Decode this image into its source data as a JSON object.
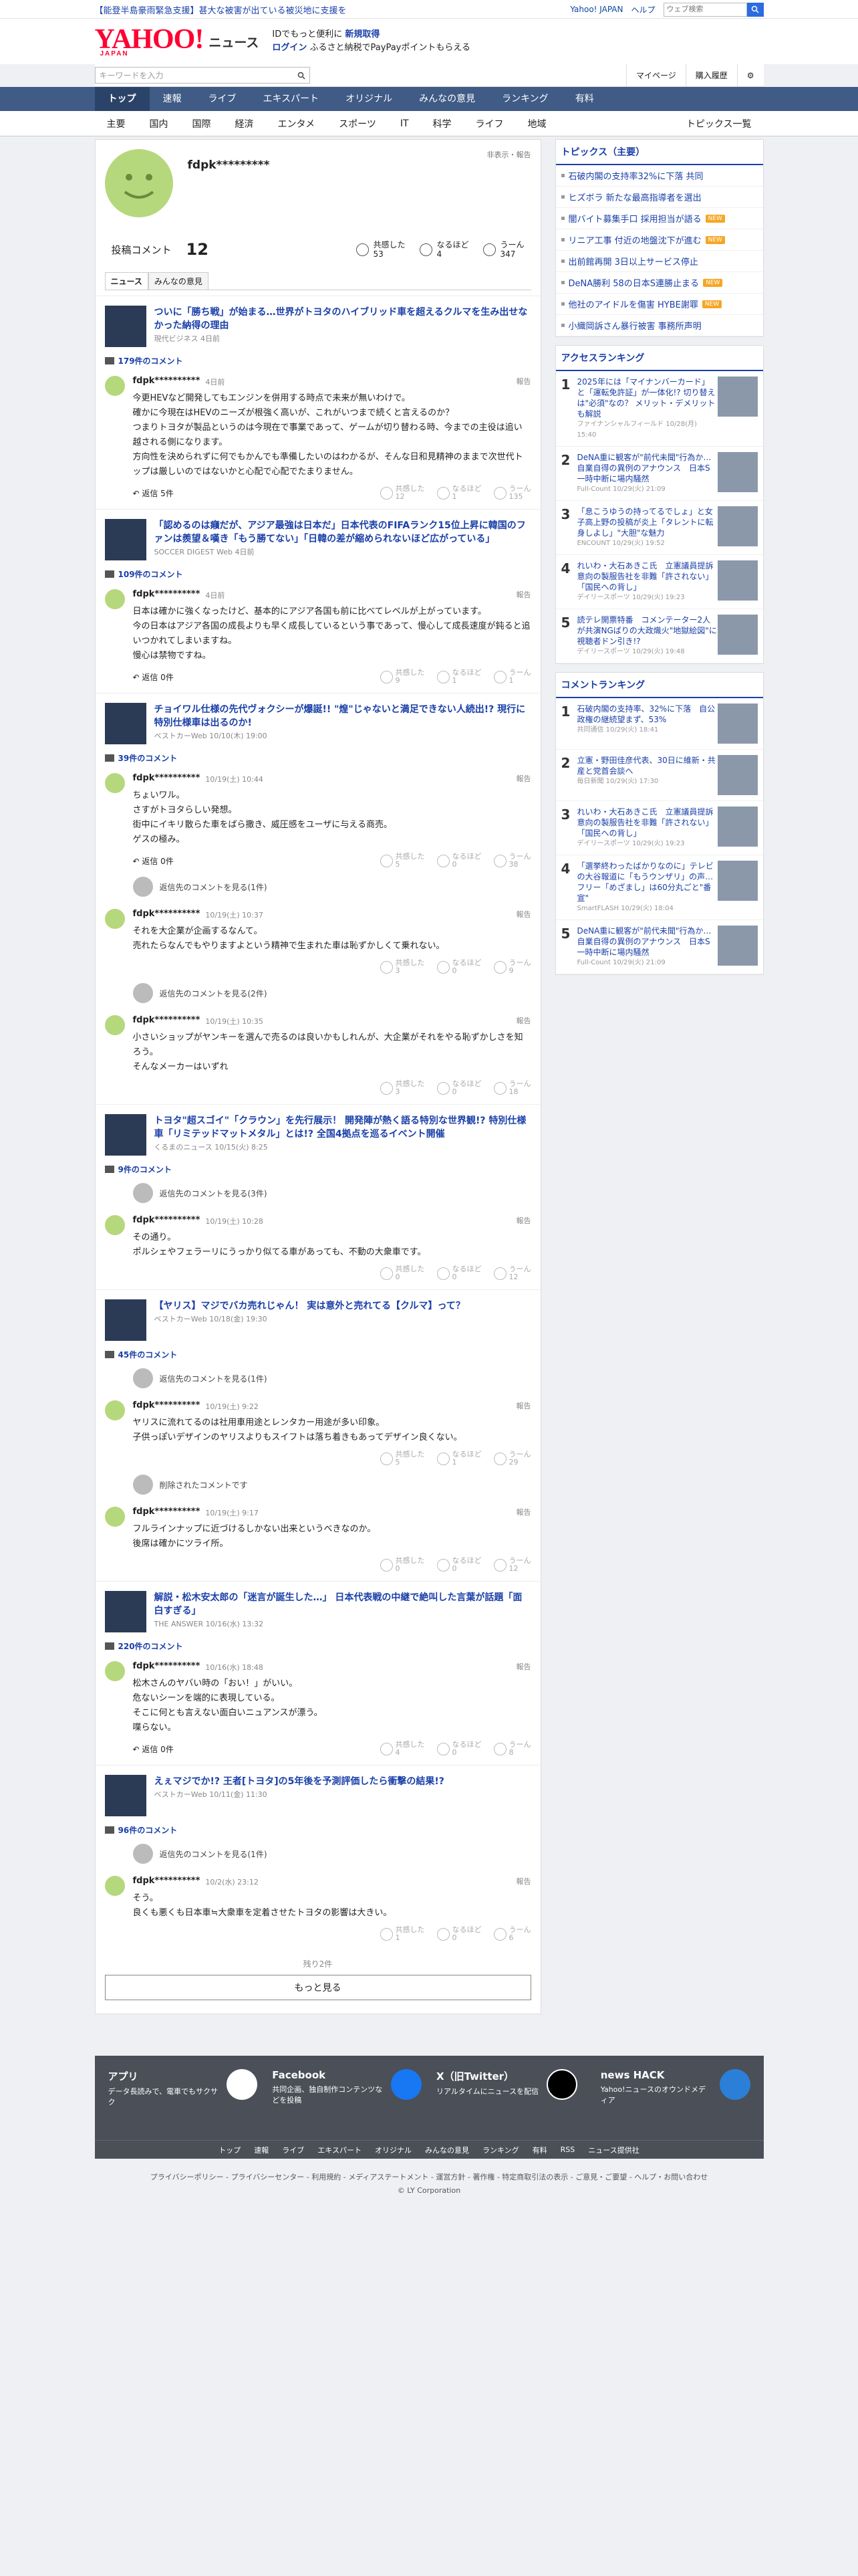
{
  "top": {
    "alert": "【能登半島豪雨緊急支援】甚大な被害が出ている被災地に支援を",
    "links": [
      "Yahoo! JAPAN",
      "ヘルプ"
    ],
    "search_placeholder": "ウェブ検索"
  },
  "header": {
    "logo": "YAHOO!",
    "logo_sub": "JAPAN",
    "logo_text": "ニュース",
    "promo1": "IDでもっと便利に",
    "promo1b": "新規取得",
    "promo2": "ログイン",
    "promo2b": "ふるさと納税でPayPayポイントもらえる"
  },
  "bar2": {
    "kw_placeholder": "キーワードを入力",
    "links": [
      "マイページ",
      "購入履歴"
    ]
  },
  "gnav": [
    "トップ",
    "速報",
    "ライブ",
    "エキスパート",
    "オリジナル",
    "みんなの意見",
    "ランキング",
    "有料"
  ],
  "snav": [
    "主要",
    "国内",
    "国際",
    "経済",
    "エンタメ",
    "スポーツ",
    "IT",
    "科学",
    "ライフ",
    "地域"
  ],
  "snav_right": "トピックス一覧",
  "profile": {
    "name": "fdpk*********",
    "report": "非表示・報告",
    "comments_label": "投稿コメント",
    "comments": "12",
    "reactions": [
      {
        "l": "共感した",
        "n": "53"
      },
      {
        "l": "なるほど",
        "n": "4"
      },
      {
        "l": "うーん",
        "n": "347"
      }
    ]
  },
  "tabs": [
    "ニュース",
    "みんなの意見"
  ],
  "articles": [
    {
      "title": "ついに「勝ち戦」が始まる…世界がトヨタのハイブリッド車を超えるクルマを生み出せなかった納得の理由",
      "src": "現代ビジネス 4日前",
      "count": "179件のコメント",
      "comments": [
        {
          "user": "fdpk**********",
          "date": "4日前",
          "text": "今更HEVなど開発してもエンジンを併用する時点で未来が無いわけで。\n確かに今現在はHEVのニーズが根強く高いが、これがいつまで続くと言えるのか？\nつまりトヨタが製品というのは今現在で事業であって、ゲームが切り替わる時、今までの主役は追い越される側になります。\n方向性を決められずに何でもかんでも準備したいのはわかるが、そんな日和見精神のままで次世代トップは厳しいのではないかと心配で心配でたまりません。",
          "reply": "返信 5件",
          "r": [
            "12",
            "1",
            "135"
          ]
        }
      ]
    },
    {
      "title": "「認めるのは癪だが、アジア最強は日本だ」日本代表のFIFAランク15位上昇に韓国のファンは羨望＆嘆き「もう勝てない」「日韓の差が縮められないほど広がっている」",
      "src": "SOCCER DIGEST Web 4日前",
      "count": "109件のコメント",
      "comments": [
        {
          "user": "fdpk**********",
          "date": "4日前",
          "text": "日本は確かに強くなったけど、基本的にアジア各国も前に比べてレベルが上がっています。\n今の日本はアジア各国の成長よりも早く成長しているという事であって、慢心して成長速度が鈍ると追いつかれてしまいますね。\n慢心は禁物ですね。",
          "reply": "返信 0件",
          "r": [
            "9",
            "1",
            "1"
          ]
        }
      ]
    },
    {
      "title": "チョイワル仕様の先代ヴォクシーが爆誕!! \"煌\"じゃないと満足できない人続出!? 現行に特別仕様車は出るのか!",
      "src": "ベストカーWeb 10/10(木) 19:00",
      "count": "39件のコメント",
      "comments": [
        {
          "user": "fdpk**********",
          "date": "10/19(土) 10:44",
          "text": "ちょいワル。\nさすがトヨタらしい発想。\n街中にイキリ散らた車をばら撒き、威圧感をユーザに与える商売。\nゲスの極み。",
          "reply": "返信 0件",
          "r": [
            "5",
            "0",
            "38"
          ]
        },
        {
          "user": "fdpk**********",
          "date": "10/19(土) 10:37",
          "text": "それを大企業が企画するなんて。\n売れたらなんでもやりますよという精神で生まれた車は恥ずかしくて乗れない。",
          "reply": "",
          "r": [
            "3",
            "0",
            "9"
          ],
          "more": "返信先のコメントを見る(1件)"
        },
        {
          "user": "fdpk**********",
          "date": "10/19(土) 10:35",
          "text": "小さいショップがヤンキーを選んで売るのは良いかもしれんが、大企業がそれをやる恥ずかしさを知ろう。\nそんなメーカーはいずれ",
          "reply": "",
          "r": [
            "3",
            "0",
            "18"
          ],
          "more": "返信先のコメントを見る(2件)"
        }
      ]
    },
    {
      "title": "トヨタ\"超スゴイ\"「クラウン」を先行展示！ 開発陣が熱く語る特別な世界観!? 特別仕様車「リミテッドマットメタル」とは!? 全国4拠点を巡るイベント開催",
      "src": "くるまのニュース 10/15(火) 8:25",
      "count": "9件のコメント",
      "comments": [
        {
          "user": "fdpk**********",
          "date": "10/19(土) 10:28",
          "text": "その通り。\nポルシェやフェラーリにうっかり似てる車があっても、不動の大衆車です。",
          "reply": "",
          "r": [
            "0",
            "0",
            "12"
          ],
          "more": "返信先のコメントを見る(3件)"
        }
      ]
    },
    {
      "title": "【ヤリス】マジでバカ売れじゃん！ 実は意外と売れてる【クルマ】って？",
      "src": "ベストカーWeb 10/18(金) 19:30",
      "count": "45件のコメント",
      "comments": [
        {
          "user": "fdpk**********",
          "date": "10/19(土) 9:22",
          "text": "ヤリスに流れてるのは社用車用途とレンタカー用途が多い印象。\n子供っぽいデザインのヤリスよりもスイフトは落ち着きもあってデザイン良くない。",
          "reply": "",
          "r": [
            "5",
            "1",
            "29"
          ],
          "more": "返信先のコメントを見る(1件)"
        },
        {
          "user": "fdpk**********",
          "date": "10/19(土) 9:17",
          "text": "フルラインナップに近づけるしかない出来というべきなのか。\n後席は確かにツライ所。",
          "reply": "",
          "r": [
            "0",
            "0",
            "12"
          ],
          "more": "削除されたコメントです"
        }
      ]
    },
    {
      "title": "解説・松木安太郎の「迷言が誕生した…」 日本代表戦の中継で絶叫した言葉が話題「面白すぎる」",
      "src": "THE ANSWER 10/16(水) 13:32",
      "count": "220件のコメント",
      "comments": [
        {
          "user": "fdpk**********",
          "date": "10/16(水) 18:48",
          "text": "松木さんのヤバい時の「おい！」がいい。\n危ないシーンを端的に表現している。\nそこに何とも言えない面白いニュアンスが漂う。\n喋らない。",
          "reply": "返信 0件",
          "r": [
            "4",
            "0",
            "8"
          ]
        }
      ]
    },
    {
      "title": "えぇマジでか!? 王者[トヨタ]の5年後を予測評価したら衝撃の結果!?",
      "src": "ベストカーWeb 10/11(金) 11:30",
      "count": "96件のコメント",
      "comments": [
        {
          "user": "fdpk**********",
          "date": "10/2(水) 23:12",
          "text": "そう。\n良くも悪くも日本車≒大衆車を定着させたトヨタの影響は大きい。",
          "reply": "",
          "r": [
            "1",
            "0",
            "6"
          ],
          "more": "返信先のコメントを見る(1件)"
        }
      ]
    }
  ],
  "remain": "残り2件",
  "more_button": "もっと見る",
  "side": {
    "topics_title": "トピックス（主要）",
    "topics": [
      {
        "t": "石破内閣の支持率32%に下落 共同",
        "n": false
      },
      {
        "t": "ヒズボラ 新たな最高指導者を選出",
        "n": false
      },
      {
        "t": "闇バイト募集手口 採用担当が語る",
        "n": true
      },
      {
        "t": "リニア工事 付近の地盤沈下が進む",
        "n": true
      },
      {
        "t": "出前館再開 3日以上サービス停止",
        "n": false
      },
      {
        "t": "DeNA勝利 58の日本S連勝止まる",
        "n": true
      },
      {
        "t": "他社のアイドルを傷害 HYBE謝罪",
        "n": true
      },
      {
        "t": "小織岡訴さん暴行被害 事務所声明",
        "n": false
      }
    ],
    "access_title": "アクセスランキング",
    "access": [
      {
        "t": "2025年には「マイナンバーカード」と「運転免許証」が一体化!? 切り替えは\"必須\"なの？ メリット・デメリットも解説",
        "s": "ファイナンシャルフィールド 10/28(月) 15:40"
      },
      {
        "t": "DeNA重に観客が\"前代未聞\"行為か…自業自得の異例のアナウンス　日本S一時中断に場内騒然",
        "s": "Full-Count 10/29(火) 21:09"
      },
      {
        "t": "「息こうゆうの持ってるでしょ」と女子高上野の投稿が炎上「タレントに転身しよし」\"大胆\"な魅力",
        "s": "ENCOUNT 10/29(火) 19:52"
      },
      {
        "t": "れいわ・大石あきこ氏　立憲議員提訴意向の製服告社を非難「許されない」「国民への背し」",
        "s": "デイリースポーツ 10/29(火) 19:23"
      },
      {
        "t": "読テレ開票特番　コメンテーター2人が共演NGばりの大政熾火\"地獄絵図\"に視聴者ドン引き!?",
        "s": "デイリースポーツ 10/29(火) 19:48"
      }
    ],
    "comment_title": "コメントランキング",
    "crank": [
      {
        "t": "石破内閣の支持率、32%に下落　自公政権の継続望まず、53%",
        "s": "共同通信 10/29(火) 18:41"
      },
      {
        "t": "立憲・野田佳彦代表、30日に維新・共産と党首会談へ",
        "s": "毎日新聞 10/29(火) 17:30"
      },
      {
        "t": "れいわ・大石あきこ氏　立憲議員提訴意向の製服告社を非難「許されない」「国民への背し」",
        "s": "デイリースポーツ 10/29(火) 19:23"
      },
      {
        "t": "「選挙終わったばかりなのに」テレビの大谷報道に「もうウンザリ」の声…フリー「めざまし」は60分丸ごと\"番宣\"",
        "s": "SmartFLASH 10/29(火) 18:04"
      },
      {
        "t": "DeNA重に観客が\"前代未聞\"行為か…自業自得の異例のアナウンス　日本S一時中断に場内騒然",
        "s": "Full-Count 10/29(火) 21:09"
      }
    ]
  },
  "footer": {
    "cols": [
      {
        "h": "アプリ",
        "t": "データ長読みで、電車でもサクサク"
      },
      {
        "h": "Facebook",
        "t": "共同企画、独自制作コンテンツなどを投稿"
      },
      {
        "h": "X（旧Twitter）",
        "t": "リアルタイムにニュースを配信"
      },
      {
        "h": "news HACK",
        "t": "Yahoo!ニュースのオウンドメディア"
      }
    ],
    "links": [
      "トップ",
      "速報",
      "ライブ",
      "エキスパート",
      "オリジナル",
      "みんなの意見",
      "ランキング",
      "有料",
      "RSS",
      "ニュース提供社"
    ],
    "legal": "プライバシーポリシー - プライバシーセンター - 利用規約 - メディアステートメント - 運営方針 - 著作権 - 特定商取引法の表示 - ご意見・ご要望 - ヘルプ・お問い合わせ",
    "copy": "© LY Corporation"
  }
}
